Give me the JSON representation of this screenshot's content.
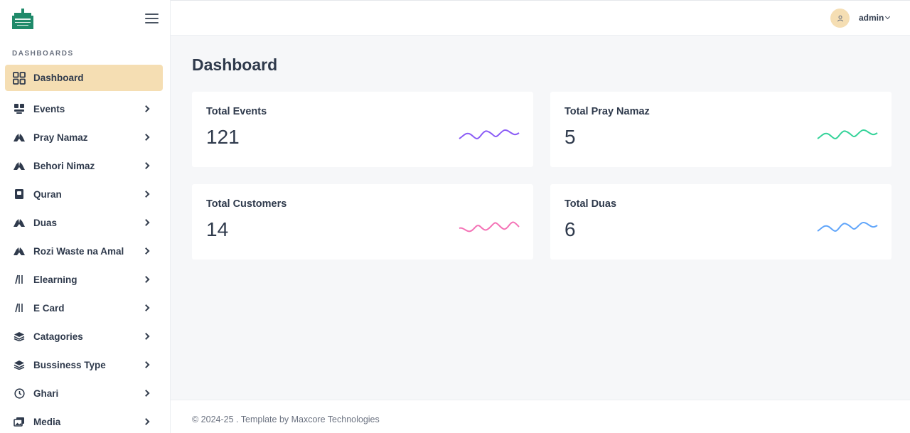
{
  "sidebar": {
    "section_title": "DASHBOARDS",
    "items": [
      {
        "label": "Dashboard",
        "icon": "grid-icon",
        "active": true,
        "has_children": false
      },
      {
        "label": "Events",
        "icon": "events-icon",
        "active": false,
        "has_children": true
      },
      {
        "label": "Pray Namaz",
        "icon": "prayer-hands-icon",
        "active": false,
        "has_children": true
      },
      {
        "label": "Behori Nimaz",
        "icon": "prayer-hands-icon",
        "active": false,
        "has_children": true
      },
      {
        "label": "Quran",
        "icon": "book-icon",
        "active": false,
        "has_children": true
      },
      {
        "label": "Duas",
        "icon": "prayer-hands-icon",
        "active": false,
        "has_children": true
      },
      {
        "label": "Rozi Waste na Amal",
        "icon": "prayer-hands-icon",
        "active": false,
        "has_children": true
      },
      {
        "label": "Elearning",
        "icon": "books-icon",
        "active": false,
        "has_children": true
      },
      {
        "label": "E Card",
        "icon": "books-icon",
        "active": false,
        "has_children": true
      },
      {
        "label": "Catagories",
        "icon": "layers-icon",
        "active": false,
        "has_children": true
      },
      {
        "label": "Bussiness Type",
        "icon": "layers-icon",
        "active": false,
        "has_children": true
      },
      {
        "label": "Ghari",
        "icon": "clock-icon",
        "active": false,
        "has_children": true
      },
      {
        "label": "Media",
        "icon": "images-icon",
        "active": false,
        "has_children": true
      }
    ]
  },
  "header": {
    "user_name": "admin"
  },
  "main": {
    "title": "Dashboard",
    "cards": [
      {
        "title": "Total Events",
        "value": "121",
        "spark_color": "#8b5cf6"
      },
      {
        "title": "Total Pray Namaz",
        "value": "5",
        "spark_color": "#34d399"
      },
      {
        "title": "Total Customers",
        "value": "14",
        "spark_color": "#f472b6"
      },
      {
        "title": "Total Duas",
        "value": "6",
        "spark_color": "#60a5fa"
      }
    ]
  },
  "footer": {
    "text": "© 2024-25 . Template by Maxcore Technologies"
  },
  "colors": {
    "accent": "#f5deb3",
    "brand_green": "#1f8a6a"
  }
}
